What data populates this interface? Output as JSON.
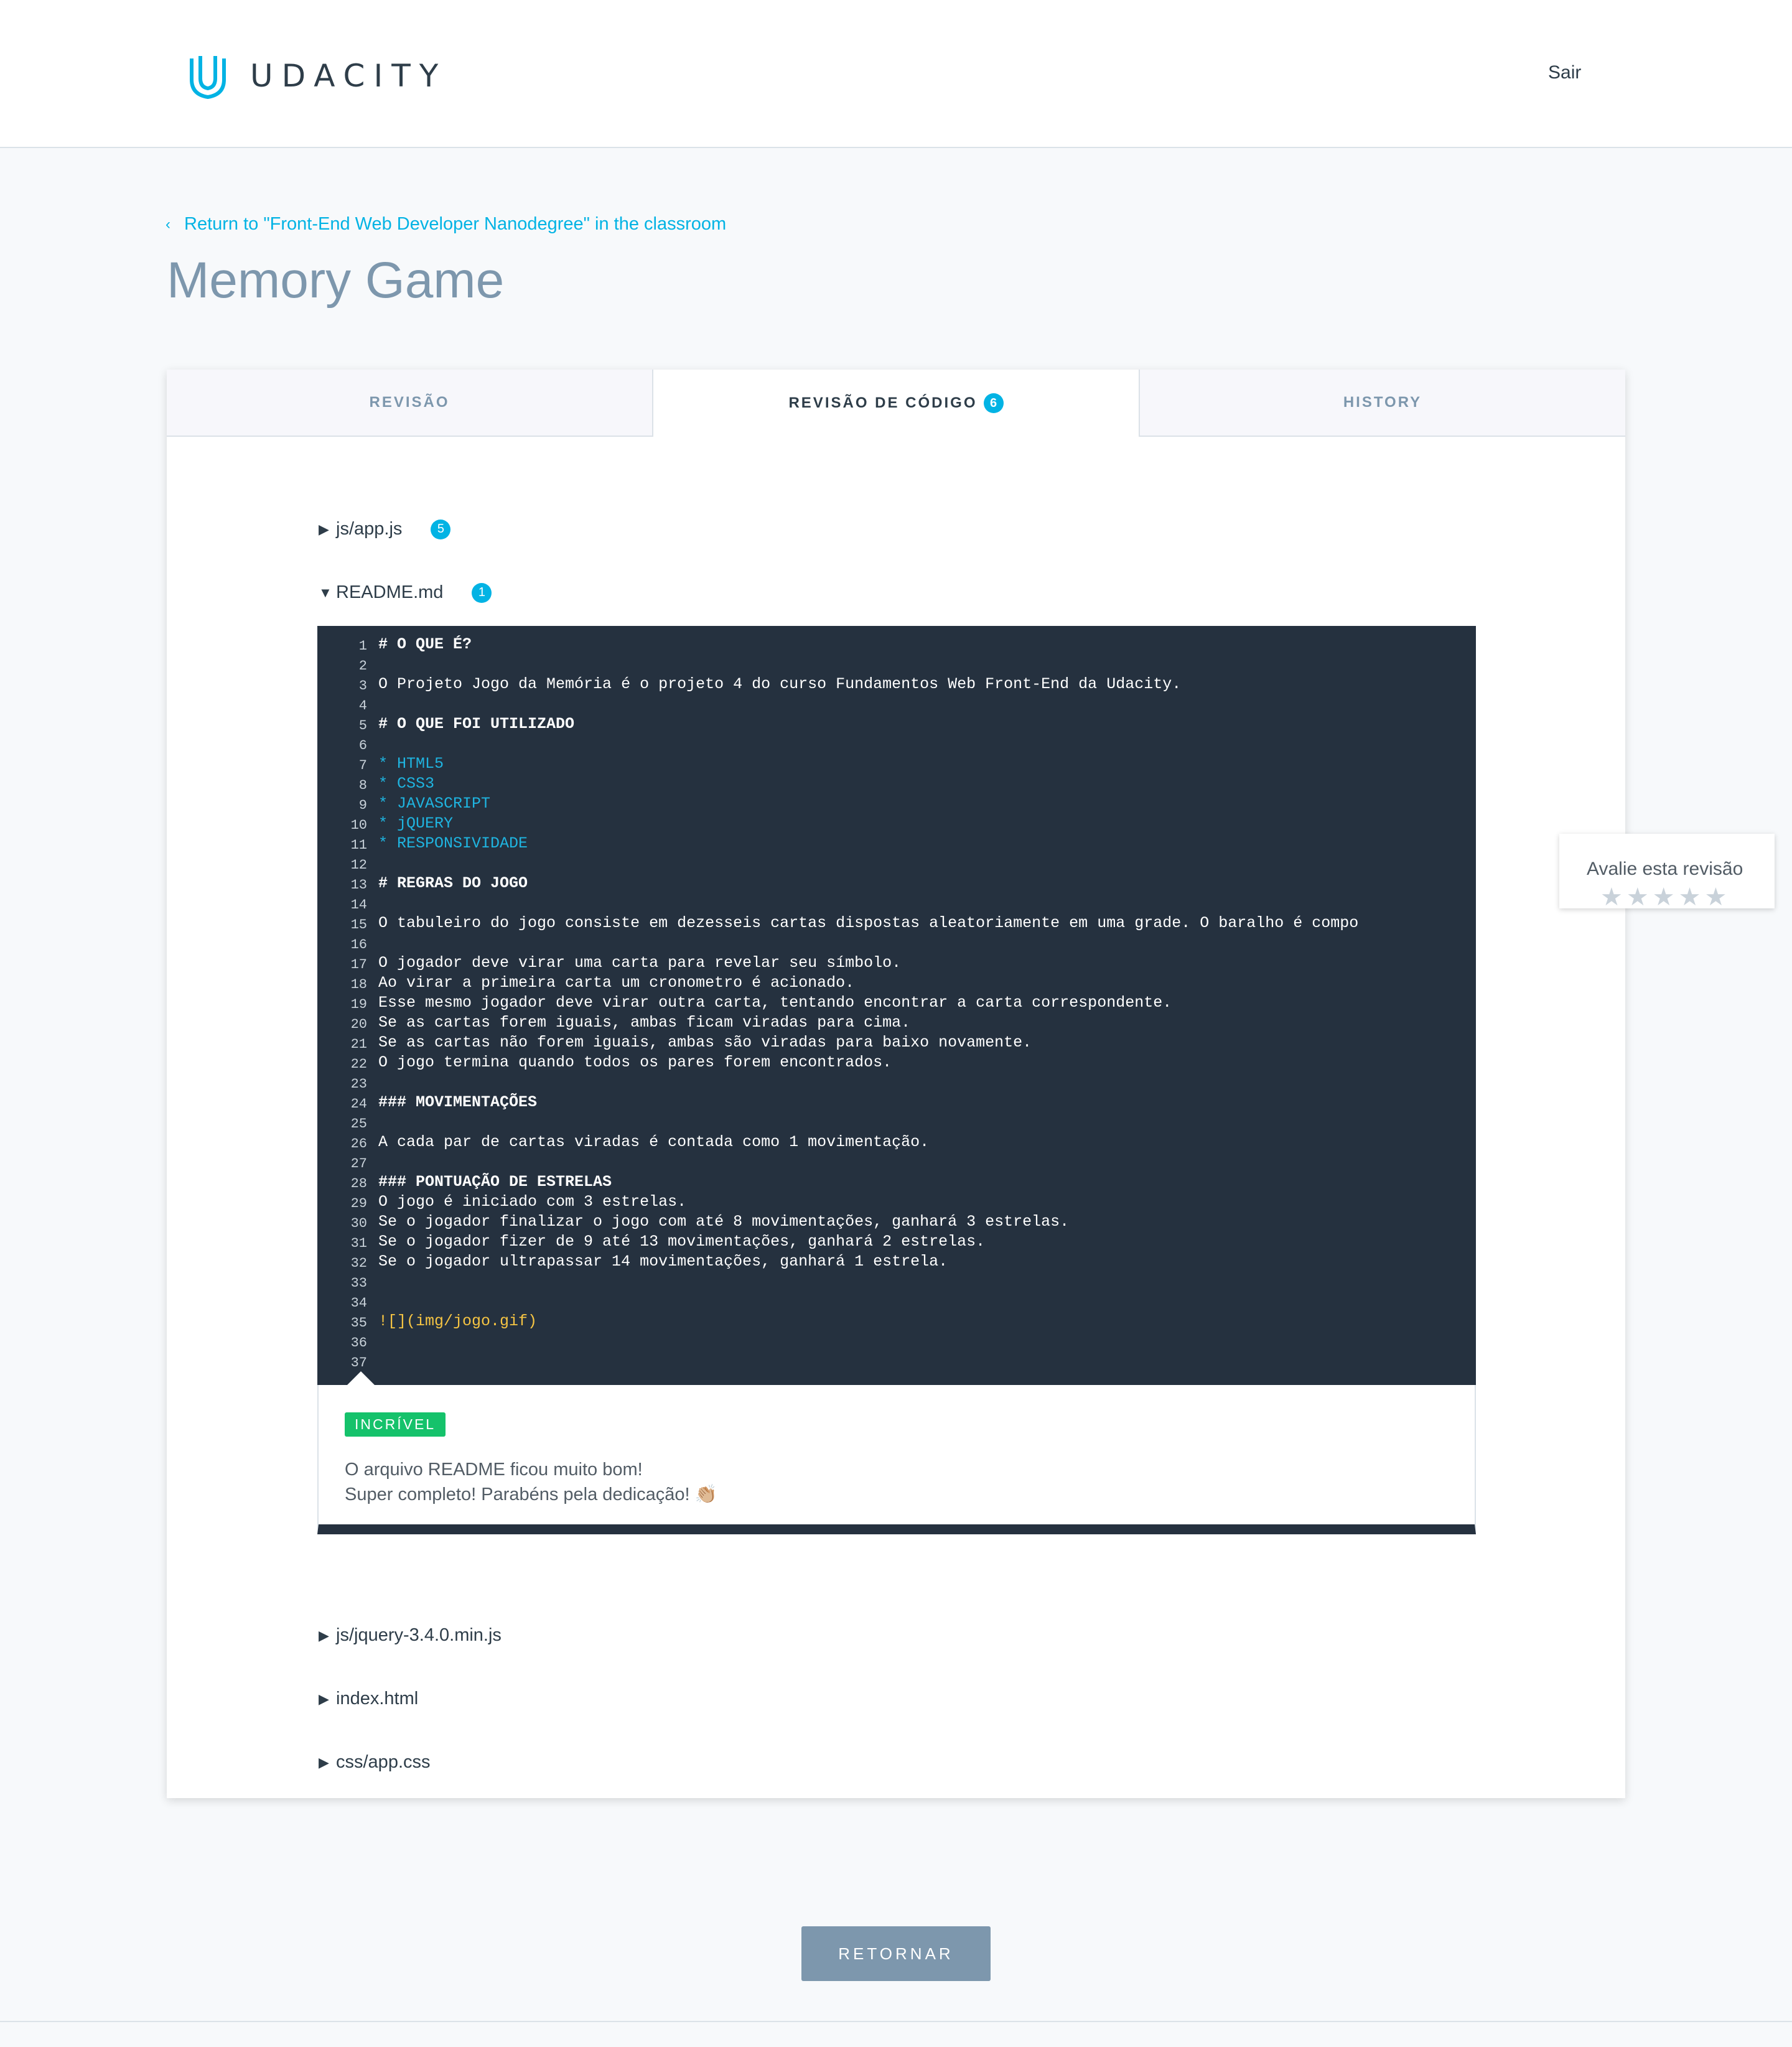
{
  "header": {
    "logo_text": "UDACITY",
    "signout_label": "Sair"
  },
  "breadcrumb": {
    "back_label": "Return to \"Front-End Web Developer Nanodegree\" in the classroom"
  },
  "page": {
    "title": "Memory Game"
  },
  "tabs": [
    {
      "label": "REVISÃO"
    },
    {
      "label": "REVISÃO DE CÓDIGO",
      "count": "6"
    },
    {
      "label": "HISTORY"
    }
  ],
  "files": [
    {
      "name": "js/app.js",
      "count": "5",
      "expanded": false
    },
    {
      "name": "README.md",
      "count": "1",
      "expanded": true
    },
    {
      "name": "js/jquery-3.4.0.min.js",
      "expanded": false
    },
    {
      "name": "index.html",
      "expanded": false
    },
    {
      "name": "css/app.css",
      "expanded": false
    }
  ],
  "code_lines": [
    {
      "n": "1",
      "text": "# O QUE É?",
      "style": "h"
    },
    {
      "n": "2",
      "text": "",
      "style": ""
    },
    {
      "n": "3",
      "text": "O Projeto Jogo da Memória é o projeto 4 do curso Fundamentos Web Front-End da Udacity.",
      "style": ""
    },
    {
      "n": "4",
      "text": "",
      "style": ""
    },
    {
      "n": "5",
      "text": "# O QUE FOI UTILIZADO",
      "style": "h"
    },
    {
      "n": "6",
      "text": "",
      "style": ""
    },
    {
      "n": "7",
      "text": "* HTML5",
      "style": "li"
    },
    {
      "n": "8",
      "text": "* CSS3",
      "style": "li"
    },
    {
      "n": "9",
      "text": "* JAVASCRIPT",
      "style": "li"
    },
    {
      "n": "10",
      "text": "* jQUERY",
      "style": "li"
    },
    {
      "n": "11",
      "text": "* RESPONSIVIDADE",
      "style": "li"
    },
    {
      "n": "12",
      "text": "",
      "style": ""
    },
    {
      "n": "13",
      "text": "# REGRAS DO JOGO",
      "style": "h"
    },
    {
      "n": "14",
      "text": "",
      "style": ""
    },
    {
      "n": "15",
      "text": "O tabuleiro do jogo consiste em dezesseis cartas dispostas aleatoriamente em uma grade. O baralho é compo",
      "style": ""
    },
    {
      "n": "16",
      "text": "",
      "style": ""
    },
    {
      "n": "17",
      "text": "O jogador deve virar uma carta para revelar seu símbolo.",
      "style": ""
    },
    {
      "n": "18",
      "text": "Ao virar a primeira carta um cronometro é acionado.",
      "style": ""
    },
    {
      "n": "19",
      "text": "Esse mesmo jogador deve virar outra carta, tentando encontrar a carta correspondente.",
      "style": ""
    },
    {
      "n": "20",
      "text": "Se as cartas forem iguais, ambas ficam viradas para cima.",
      "style": ""
    },
    {
      "n": "21",
      "text": "Se as cartas não forem iguais, ambas são viradas para baixo novamente.",
      "style": ""
    },
    {
      "n": "22",
      "text": "O jogo termina quando todos os pares forem encontrados.",
      "style": ""
    },
    {
      "n": "23",
      "text": "",
      "style": ""
    },
    {
      "n": "24",
      "text": "### MOVIMENTAÇÕES",
      "style": "h"
    },
    {
      "n": "25",
      "text": "",
      "style": ""
    },
    {
      "n": "26",
      "text": "A cada par de cartas viradas é contada como 1 movimentação.",
      "style": ""
    },
    {
      "n": "27",
      "text": "",
      "style": ""
    },
    {
      "n": "28",
      "text": "### PONTUAÇÃO DE ESTRELAS",
      "style": "h"
    },
    {
      "n": "29",
      "text": "O jogo é iniciado com 3 estrelas.",
      "style": ""
    },
    {
      "n": "30",
      "text": "Se o jogador finalizar o jogo com até 8 movimentações, ganhará 3 estrelas.",
      "style": ""
    },
    {
      "n": "31",
      "text": "Se o jogador fizer de 9 até 13 movimentações, ganhará 2 estrelas.",
      "style": ""
    },
    {
      "n": "32",
      "text": "Se o jogador ultrapassar 14 movimentações, ganhará 1 estrela.",
      "style": ""
    },
    {
      "n": "33",
      "text": "",
      "style": ""
    },
    {
      "n": "34",
      "text": "",
      "style": ""
    },
    {
      "n": "35",
      "text": "![](img/jogo.gif)",
      "style": "img"
    },
    {
      "n": "36",
      "text": "",
      "style": ""
    },
    {
      "n": "37",
      "text": "",
      "style": ""
    }
  ],
  "comment": {
    "badge": "INCRÍVEL",
    "line1": "O arquivo README ficou muito bom!",
    "line2": "Super completo! Parabéns pela dedicação!",
    "emoji": "👏🏼"
  },
  "rating": {
    "title": "Avalie esta revisão",
    "stars": 5,
    "star_glyph": "★"
  },
  "return_button": "RETORNAR",
  "colors": {
    "accent": "#02b3e4",
    "badge_green": "#15c26b",
    "code_bg": "#25313f"
  }
}
